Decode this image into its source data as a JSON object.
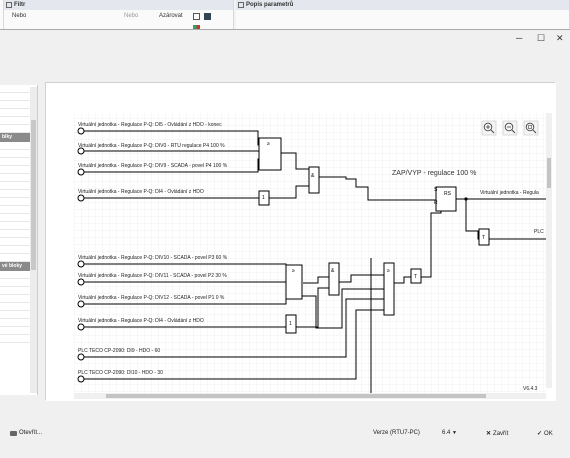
{
  "background": {
    "panel1": {
      "title": ""
    },
    "filter": {
      "title": "Filtr",
      "mode": "Nebo",
      "option_disabled": "Nebo",
      "sort_label": "Azárovat"
    },
    "params": {
      "title": "Popis parametrů"
    }
  },
  "left_panel": {
    "heading1": "blky",
    "heading2": "vé bloky"
  },
  "diagram": {
    "version": "V6.4.3",
    "title": "ZAP/VYP - regulace 100 %",
    "inputs": [
      "Virtuální jednotka - Regulace P-Q: DI5 - Ovládání z HDO - konec",
      "Virtuální jednotka - Regulace P-Q: DIV0 - RTU regulace P4 100 %",
      "Virtuální jednotka - Regulace P-Q: DIV9 - SCADA - povel P4 100 %",
      "Virtuální jednotka - Regulace P-Q: DI4 - Ovládání z HDO",
      "Virtuální jednotka - Regulace P-Q: DIV10 - SCADA - povel P3 60 %",
      "Virtuální jednotka - Regulace P-Q: DIV11 - SCADA - povel P2 30 %",
      "Virtuální jednotka - Regulace P-Q: DIV12 - SCADA - povel P1 0 %",
      "Virtuální jednotka - Regulace P-Q: DI4 - Ovládání z HDO",
      "PLC TECO CP-2090: DI9 - HDO - 60",
      "PLC TECO CP-2090: DI10 - HDO - 30"
    ],
    "output1": "Virtuální jednotka - Regula",
    "output2": "PLC",
    "gates": {
      "and": "&",
      "or": "≥",
      "not": "1",
      "timer": "T",
      "rs": "RS",
      "s": "S",
      "r": "R"
    }
  },
  "footer": {
    "open_label": "Otevřít...",
    "version_label": "Verze (RTU7-PC)",
    "version_value": "6.4",
    "close_label": "Zavřít",
    "ok_label": "OK"
  },
  "colors": {
    "wire": "#000000",
    "grid": "#e6e6e6",
    "panel": "#f0f0f0"
  }
}
